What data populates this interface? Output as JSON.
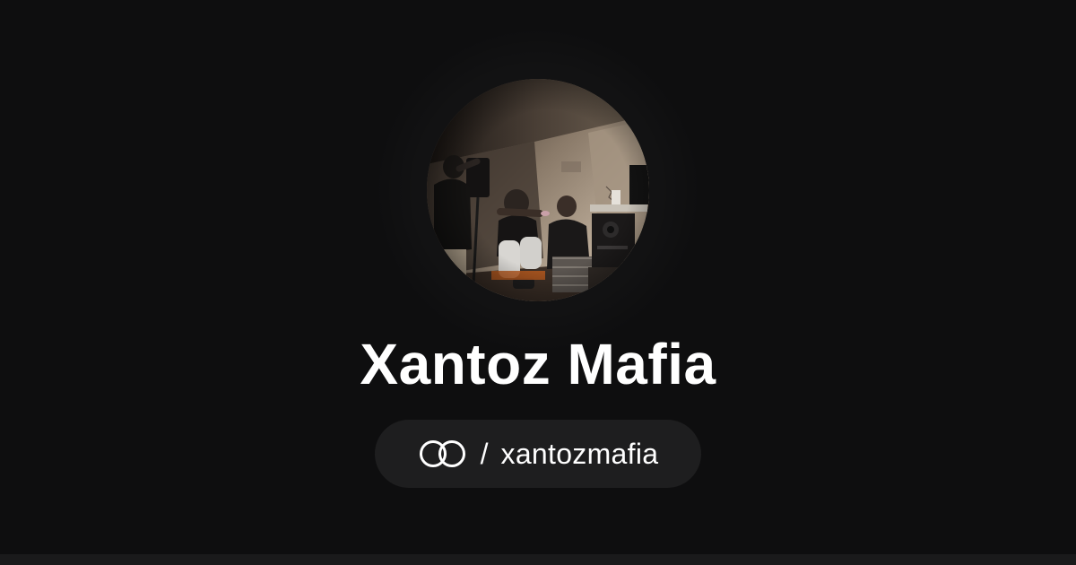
{
  "profile": {
    "name": "Xantoz Mafia",
    "handle_prefix": "/",
    "handle": "xantozmafia",
    "avatar_alt": "Xantoz Mafia profile photo"
  },
  "icons": {
    "brand": "linked-rings-logo-icon"
  },
  "colors": {
    "background": "#0e0e0f",
    "pill_background": "#1e1e1f",
    "text": "#ffffff"
  }
}
